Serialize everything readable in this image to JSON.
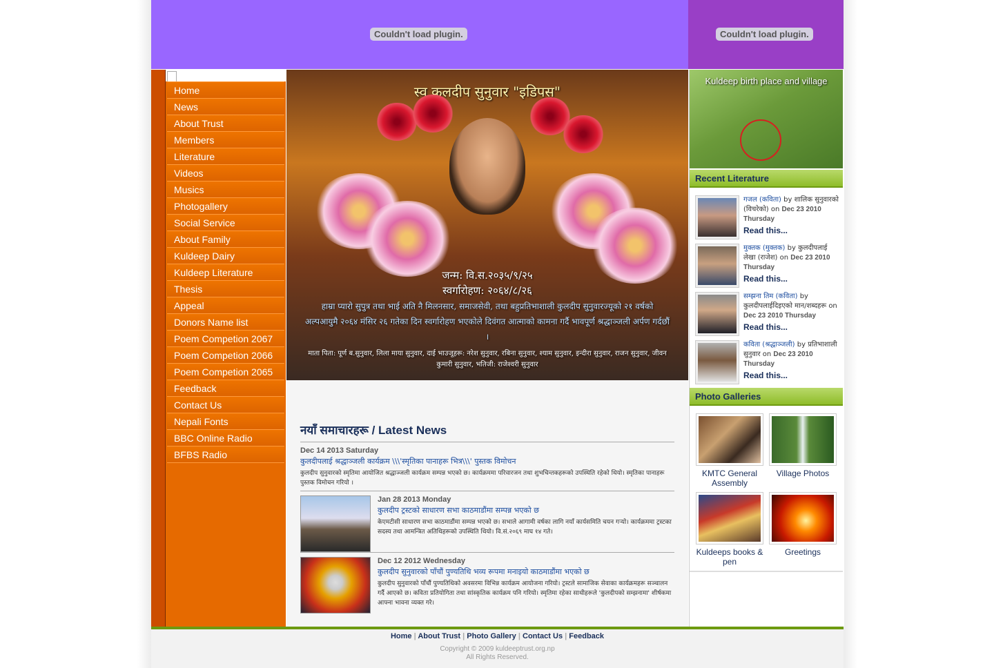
{
  "banner": {
    "left_plugin_msg": "Couldn't load plugin.",
    "right_plugin_msg": "Couldn't load plugin."
  },
  "nav": {
    "items": [
      {
        "label": "Home"
      },
      {
        "label": "News"
      },
      {
        "label": "About Trust"
      },
      {
        "label": "Members"
      },
      {
        "label": "Literature"
      },
      {
        "label": "Videos"
      },
      {
        "label": "Musics"
      },
      {
        "label": "Photogallery"
      },
      {
        "label": "Social Service"
      },
      {
        "label": "About Family"
      },
      {
        "label": "Kuldeep Dairy"
      },
      {
        "label": "Kuldeep Literature"
      },
      {
        "label": "Thesis"
      },
      {
        "label": "Appeal"
      },
      {
        "label": "Donors Name list"
      },
      {
        "label": "Poem Competion 2067"
      },
      {
        "label": "Poem Competion 2066"
      },
      {
        "label": "Poem Competion 2065"
      },
      {
        "label": "Feedback"
      },
      {
        "label": "Contact Us"
      },
      {
        "label": "Nepali Fonts"
      },
      {
        "label": "BBC Online Radio"
      },
      {
        "label": "BFBS Radio"
      }
    ]
  },
  "hero": {
    "title": "स्व.कुलदीप सुनुवार \"इडिपस\"",
    "birth": "जन्म: वि.स.२०३५/९/२५",
    "death": "स्वर्गारोहण: २०६४/८/२६",
    "tribute": "हाम्रा प्यारो सुपुत्र तथा भाई अति नै मिलनसार, समाजसेवी, तथा बहुप्रतिभाशाली कुलदीप सुनुवारज्यूको २१ वर्षको अल्पआयुमै २०६४ मंसिर २६ गतेका दिन स्वर्गारोहण भएकोले दिवंगत आत्माको कामना गर्दै भावपूर्ण श्रद्धाञ्जली अर्पण गर्दछौं ।",
    "family": "माता पिता: पूर्ण ब.सुनुवार, लिला माया सुनुवार, दाई भाउजूहरू: नरेश सुनुवार, रबिना सुनुवार, श्याम सुनुवार, इन्दीरा सुनुवार, राजन सुनुवार, जीवन कुमारी सुनुवार, भतिजी: राजेश्वरी सुनुवार"
  },
  "news": {
    "heading": "नयाँ समाचारहरू / Latest News",
    "items": [
      {
        "date": "Dec 14 2013 Saturday",
        "title": "कुलदीपलाई श्रद्धाञ्जली कार्यक्रम \\\\\\'स्मृतिका पानाहरू भित्र\\\\\\' पुस्तक विमोचन",
        "body": "कुलदीप सुनुवारको स्मृतिमा आयोजित श्रद्धाञ्जली कार्यक्रम सम्पन्न भएको छ। कार्यक्रममा परिवारजन तथा शुभचिन्तकहरूको उपस्थिति रहेको थियो। स्मृतिका पानाहरू पुस्तक विमोचन गरियो ।"
      },
      {
        "date": "Jan 28 2013 Monday",
        "title": "कुलदीप ट्रस्टको साधारण सभा काठमाडौंमा सम्पन्न भएको छ",
        "body": "केएमटीसी साधारण सभा काठमाडौंमा सम्पन्न भएको छ। सभाले आगामी वर्षका लागि नयाँ कार्यसमिति चयन गर्‍यो। कार्यक्रममा ट्रस्टका सदस्य तथा आमन्त्रित अतिथिहरूको उपस्थिति थियो। वि.सं.२०६९ माघ १४ गते।"
      },
      {
        "date": "Dec 12 2012 Wednesday",
        "title": "कुलदीप सुनुवारको पाँचौं पुण्यतिथि भव्य रूपमा मनाइयो काठमाडौंमा भएको छ",
        "body": "कुलदीप सुनुवारको पाँचौं पुण्यतिथिको अवसरमा विभिन्न कार्यक्रम आयोजना गरियो। ट्रस्टले सामाजिक सेवाका कार्यक्रमहरू सञ्चालन गर्दै आएको छ। कविता प्रतियोगिता तथा सांस्कृतिक कार्यक्रम पनि गरियो। स्मृतिमा रहेका साथीहरूले 'कुलदीपको सम्झनामा' शीर्षकमा आफ्ना भावना व्यक्त गरे।"
      }
    ]
  },
  "village": {
    "caption": "Kuldeep birth place and village"
  },
  "recent_literature": {
    "heading": "Recent Literature",
    "items": [
      {
        "title": "गजल (कविता)",
        "by": "by",
        "author": "शालिक सुनुवारको (विचरेको)",
        "on": "on",
        "date": "Dec 23 2010 Thursday",
        "more": "Read this..."
      },
      {
        "title": "मुक्तक (मुक्तक)",
        "by": "by",
        "author": "कुलदीपलाई लेखा (राजेश)",
        "on": "on",
        "date": "Dec 23 2010 Thursday",
        "more": "Read this..."
      },
      {
        "title": "सम्झना तिम (कविता)",
        "by": "by",
        "author": "कुलदीपलाईदिइएको मान/शब्दहरू",
        "on": "on",
        "date": "Dec 23 2010 Thursday",
        "more": "Read this..."
      },
      {
        "title": "कविता (श्रद्धाञ्जली)",
        "by": "by",
        "author": "प्रतिभाशाली सुनुवार",
        "on": "on",
        "date": "Dec 23 2010 Thursday",
        "more": "Read this..."
      }
    ]
  },
  "photo_galleries": {
    "heading": "Photo Galleries",
    "items": [
      {
        "label": "KMTC General Assembly"
      },
      {
        "label": "Village Photos"
      },
      {
        "label": "Kuldeeps books & pen"
      },
      {
        "label": "Greetings"
      }
    ]
  },
  "footer": {
    "links": [
      "Home",
      "About Trust",
      "Photo Gallery",
      "Contact Us",
      "Feedback"
    ],
    "separator": "|",
    "copyright": "Copyright © 2009 kuldeeptrust.org.np",
    "rights": "All Rights Reserved."
  }
}
